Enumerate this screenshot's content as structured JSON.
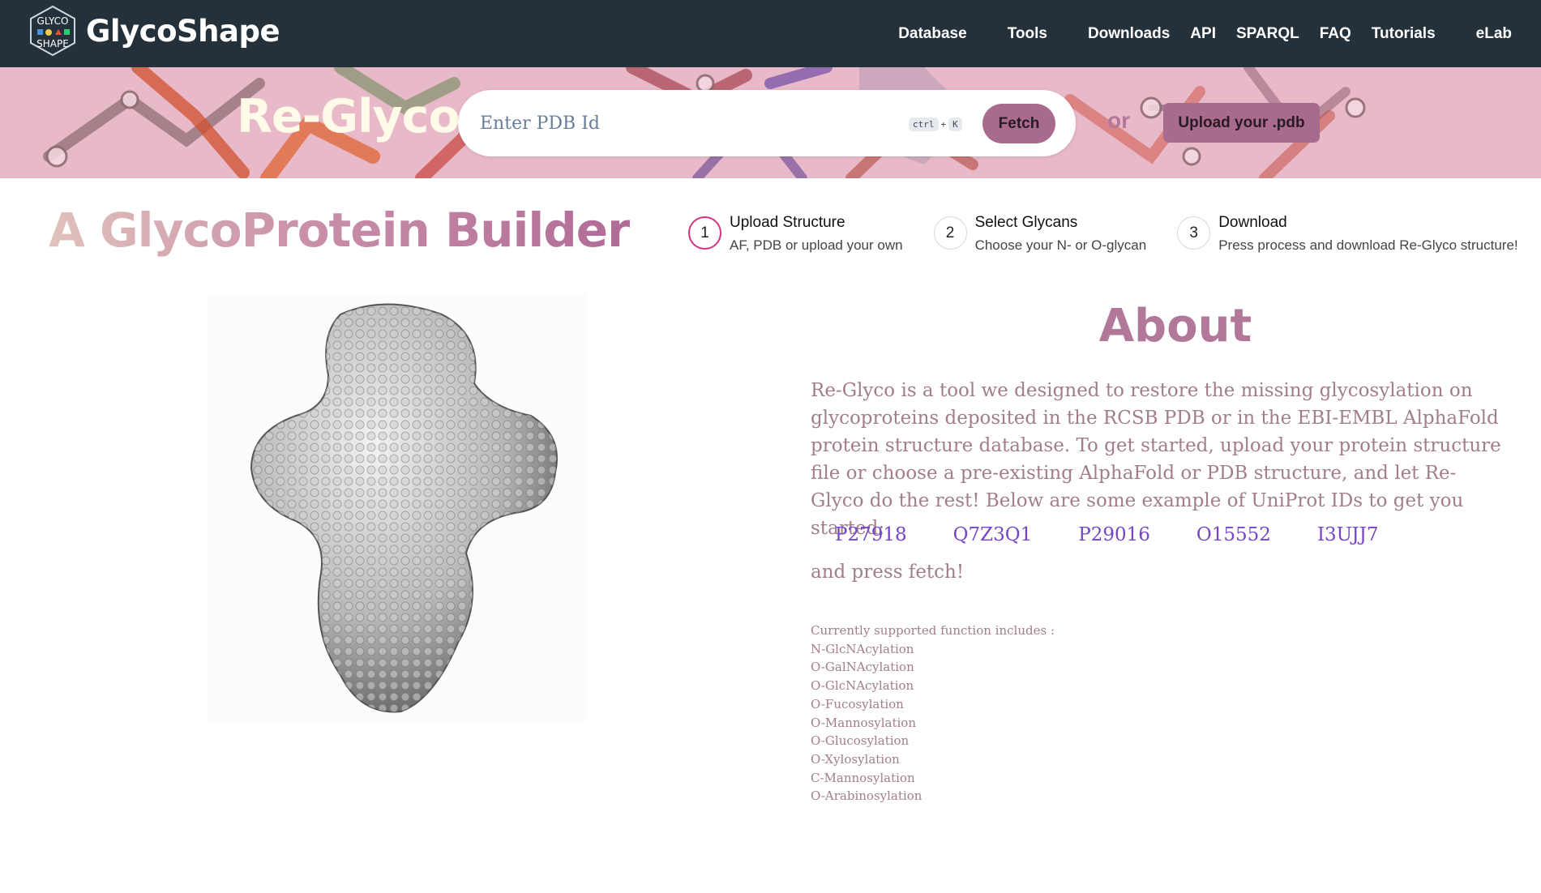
{
  "nav": {
    "logo_text": "GLYCO SHAPE",
    "brand": "GlycoShape",
    "links": [
      "Database",
      "Tools",
      "Downloads",
      "API",
      "SPARQL",
      "FAQ",
      "Tutorials",
      "eLab"
    ]
  },
  "hero": {
    "title": "Re-Glyco",
    "search_placeholder": "Enter PDB Id",
    "shortcut_ctrl": "ctrl",
    "shortcut_plus": "+",
    "shortcut_key": "K",
    "fetch_label": "Fetch",
    "or_label": "or",
    "upload_label": "Upload your .pdb"
  },
  "page_title": "A GlycoProtein Builder",
  "steps": [
    {
      "num": "1",
      "title": "Upload Structure",
      "desc": "AF, PDB or upload your own"
    },
    {
      "num": "2",
      "title": "Select Glycans",
      "desc": "Choose your N- or O-glycan"
    },
    {
      "num": "3",
      "title": "Download",
      "desc": "Press process and download Re-Glyco structure!"
    }
  ],
  "about": {
    "title": "About",
    "text": "Re-Glyco is a tool we designed to restore the missing glycosylation on glycoproteins deposited in the RCSB PDB or in the EBI-EMBL AlphaFold protein structure database. To get started, upload your protein structure file or choose a pre-existing AlphaFold or PDB structure, and let Re-Glyco do the rest! Below are some example of UniProt IDs to get you started:",
    "example_ids": [
      "P27918",
      "Q7Z3Q1",
      "P29016",
      "O15552",
      "I3UJJ7"
    ],
    "press_fetch": "and press fetch!",
    "supported_heading": "Currently supported function includes :",
    "supported": [
      "N-GlcNAcylation",
      "O-GalNAcylation",
      "O-GlcNAcylation",
      "O-Fucosylation",
      "O-Mannosylation",
      "O-Glucosylation",
      "O-Xylosylation",
      "C-Mannosylation",
      "O-Arabinosylation"
    ]
  },
  "colors": {
    "nav_bg": "#25313a",
    "hero_bg": "#e8b9c8",
    "accent": "#a86b8d",
    "about_title": "#b2789a",
    "link": "#7445c7",
    "step_active": "#d63384"
  }
}
